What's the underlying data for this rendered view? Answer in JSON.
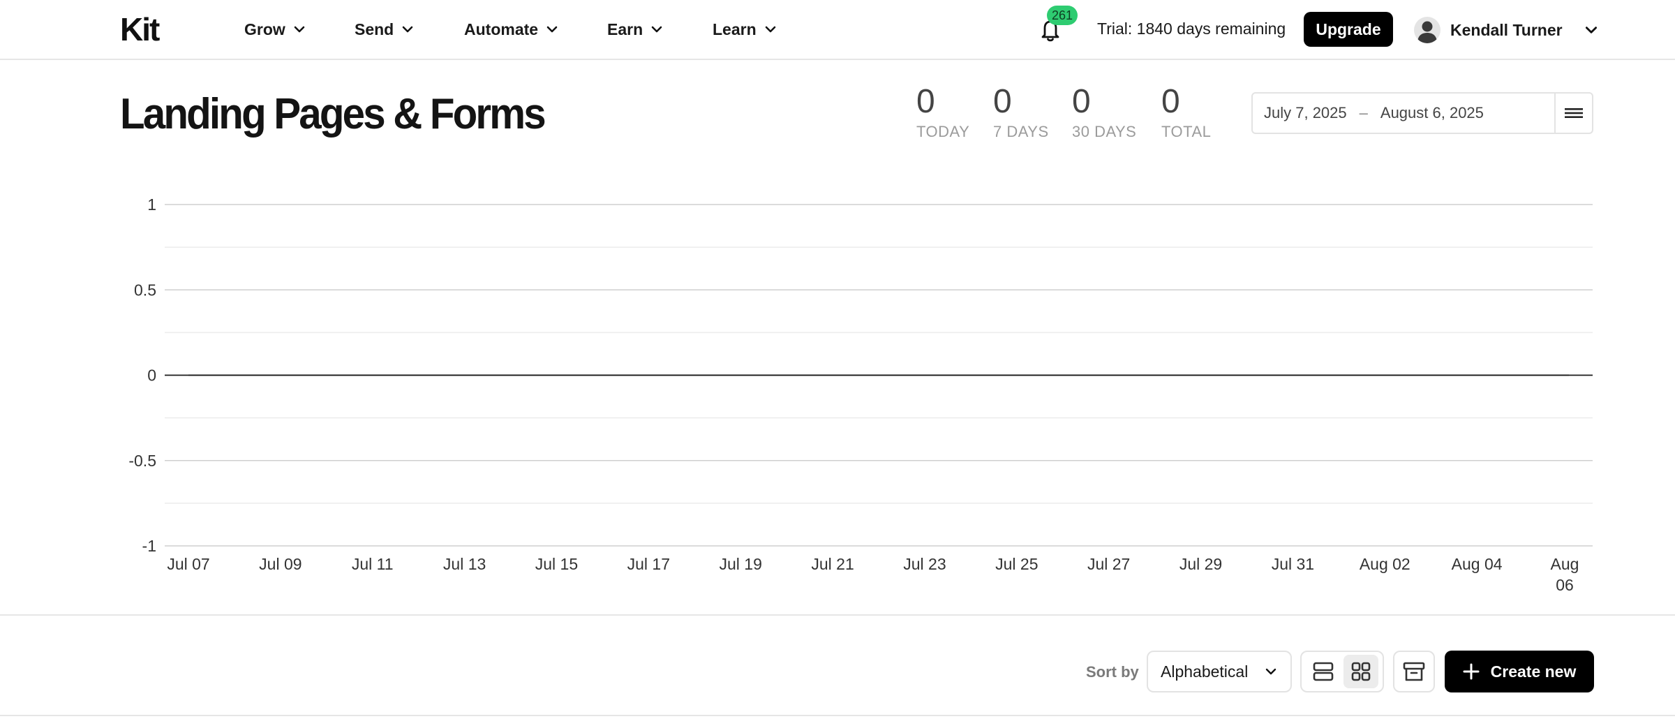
{
  "brand": {
    "logo_text": "Kit"
  },
  "nav": {
    "items": [
      {
        "label": "Grow"
      },
      {
        "label": "Send"
      },
      {
        "label": "Automate"
      },
      {
        "label": "Earn"
      },
      {
        "label": "Learn"
      }
    ],
    "notifications_count": "261",
    "trial_text": "Trial: 1840 days remaining",
    "upgrade_label": "Upgrade",
    "user_name": "Kendall Turner"
  },
  "page": {
    "title": "Landing Pages & Forms",
    "stats": [
      {
        "value": "0",
        "label": "TODAY"
      },
      {
        "value": "0",
        "label": "7 DAYS"
      },
      {
        "value": "0",
        "label": "30 DAYS"
      },
      {
        "value": "0",
        "label": "TOTAL"
      }
    ],
    "date_range": {
      "start": "July 7, 2025",
      "separator": "–",
      "end": "August 6, 2025"
    }
  },
  "chart_data": {
    "type": "line",
    "x": [
      "Jul 07",
      "Jul 09",
      "Jul 11",
      "Jul 13",
      "Jul 15",
      "Jul 17",
      "Jul 19",
      "Jul 21",
      "Jul 23",
      "Jul 25",
      "Jul 27",
      "Jul 29",
      "Jul 31",
      "Aug 02",
      "Aug 04",
      "Aug 06"
    ],
    "series": [
      {
        "values": [
          0,
          0,
          0,
          0,
          0,
          0,
          0,
          0,
          0,
          0,
          0,
          0,
          0,
          0,
          0,
          0
        ]
      }
    ],
    "y_ticks": [
      "1",
      "0.5",
      "0",
      "-0.5",
      "-1"
    ],
    "ylim": [
      -1,
      1
    ],
    "grid": true,
    "title": "",
    "xlabel": "",
    "ylabel": ""
  },
  "toolbar": {
    "sort_label": "Sort by",
    "sort_value": "Alphabetical",
    "create_label": "Create new"
  },
  "colors": {
    "badge": "#2ecc71",
    "primary_button": "#000000"
  }
}
